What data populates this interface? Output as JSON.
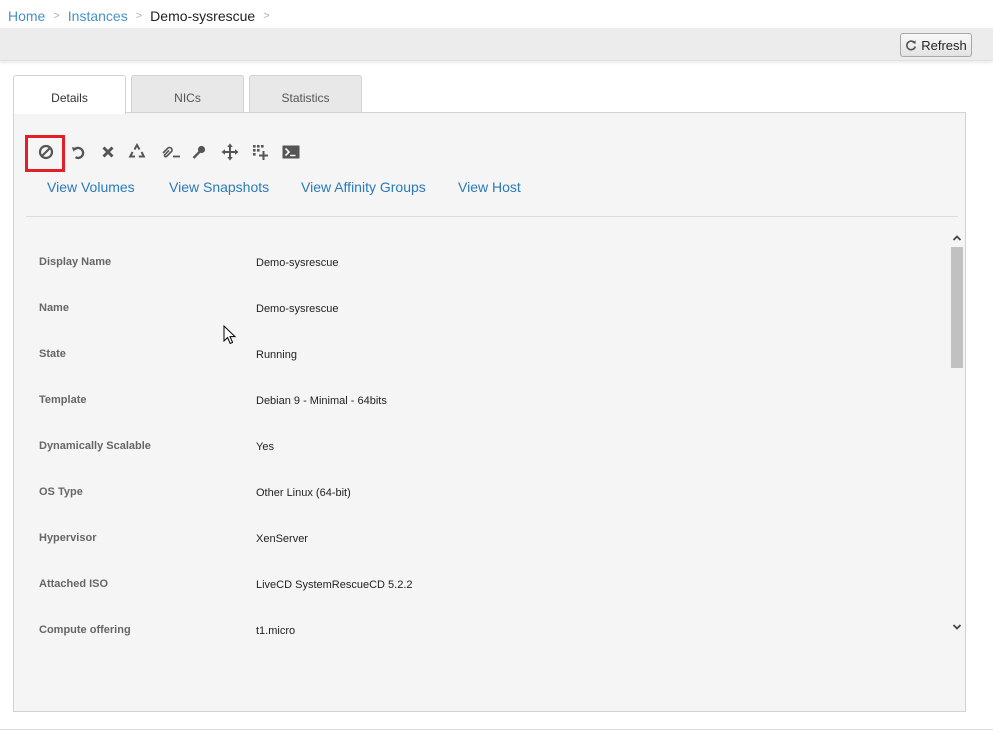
{
  "breadcrumb": {
    "items": [
      "Home",
      "Instances"
    ],
    "current": "Demo-sysrescue",
    "separator": ">"
  },
  "toolbar": {
    "refresh_label": "Refresh"
  },
  "tabs": [
    {
      "label": "Details",
      "active": true
    },
    {
      "label": "NICs",
      "active": false
    },
    {
      "label": "Statistics",
      "active": false
    }
  ],
  "actions": [
    {
      "icon": "stop-icon",
      "highlighted": true
    },
    {
      "icon": "reboot-icon"
    },
    {
      "icon": "destroy-icon"
    },
    {
      "icon": "recycle-icon"
    },
    {
      "icon": "detach-iso-icon"
    },
    {
      "icon": "reset-password-icon"
    },
    {
      "icon": "migrate-icon"
    },
    {
      "icon": "scale-icon"
    },
    {
      "icon": "console-icon"
    }
  ],
  "view_links": [
    "View Volumes",
    "View Snapshots",
    "View Affinity Groups",
    "View Host"
  ],
  "details": [
    {
      "label": "Display Name",
      "value": "Demo-sysrescue"
    },
    {
      "label": "Name",
      "value": "Demo-sysrescue"
    },
    {
      "label": "State",
      "value": "Running"
    },
    {
      "label": "Template",
      "value": "Debian 9 - Minimal - 64bits"
    },
    {
      "label": "Dynamically Scalable",
      "value": "Yes"
    },
    {
      "label": "OS Type",
      "value": "Other Linux (64-bit)"
    },
    {
      "label": "Hypervisor",
      "value": "XenServer"
    },
    {
      "label": "Attached ISO",
      "value": "LiveCD SystemRescueCD 5.2.2"
    },
    {
      "label": "Compute offering",
      "value": "t1.micro"
    }
  ],
  "colors": {
    "link": "#2a7ab8",
    "breadcrumb_link": "#4a90c8",
    "highlight": "#e21f26",
    "icon": "#555555"
  }
}
